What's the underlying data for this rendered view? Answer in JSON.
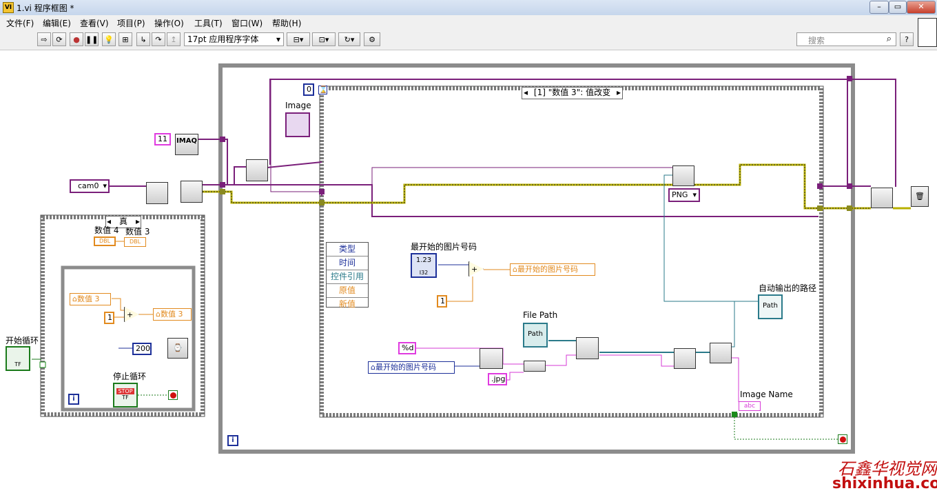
{
  "window": {
    "title": "1.vi 程序框图 *",
    "icon_label": "VI"
  },
  "menu": [
    "文件(F)",
    "编辑(E)",
    "查看(V)",
    "项目(P)",
    "操作(O)",
    "工具(T)",
    "窗口(W)",
    "帮助(H)"
  ],
  "toolbar": {
    "font": "17pt 应用程序字体",
    "search_placeholder": "搜索"
  },
  "diagram": {
    "const_11": "11",
    "imaq_label": "IMAQ",
    "camera": "cam0",
    "while_index_const": "0",
    "image_label": "Image",
    "event_selector": "[1] \"数值 3\": 值改变",
    "event_data": [
      "类型",
      "时间",
      "控件引用",
      "原值",
      "新值"
    ],
    "case_selector": "真",
    "num4_label": "数值 4",
    "num3_label": "数值 3",
    "dbl": "DBL",
    "local_num3": "数值 3",
    "const_1a": "1",
    "wait_ms": "200",
    "stop_label": "停止循环",
    "stop_text": "STOP",
    "start_label": "开始循环",
    "first_num_label": "最开始的图片号码",
    "num_ind": "1.23",
    "const_1b": "1",
    "local_first_num": "最开始的图片号码",
    "filepath_label": "File Path",
    "path_text": "Path",
    "fmt_const": "%d",
    "ext_const": ".jpg",
    "local_first_num_2": "最开始的图片号码",
    "png_const": "PNG",
    "auto_path_label": "自动输出的路径",
    "image_name_label": "Image Name",
    "abc": "abc",
    "i_label": "i",
    "tf": "TF",
    "i32": "I32"
  },
  "watermark": {
    "cn": "石鑫华视觉网",
    "url": "shixinhua.com"
  },
  "colors": {
    "cluster_wire": "#8a2a8a",
    "image_wire": "#7a1f7a",
    "error_wire": "#c8c000",
    "numeric_wire": "#e28a1e",
    "integer_wire": "#1c2f99",
    "path_wire": "#2a8a8a",
    "string_wire": "#d63ad6"
  }
}
